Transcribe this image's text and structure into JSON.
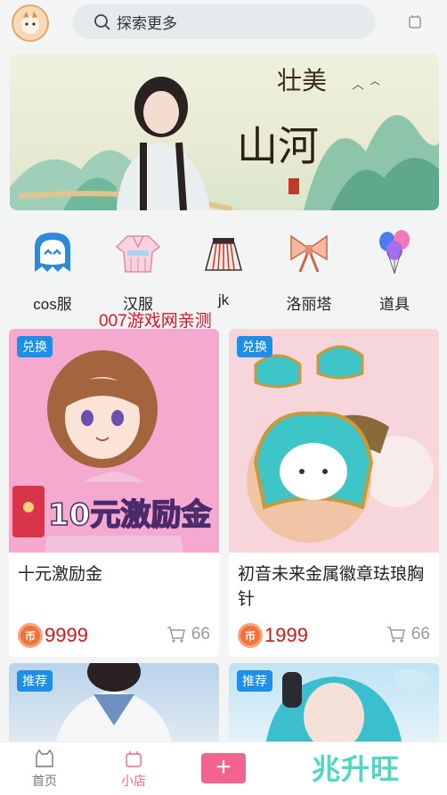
{
  "search": {
    "placeholder": "探索更多"
  },
  "banner": {
    "title_top": "壮美",
    "title_main": "山河"
  },
  "categories": [
    {
      "label": "cos服",
      "icon": "ghost-icon"
    },
    {
      "label": "汉服",
      "icon": "hanfu-icon"
    },
    {
      "label": "jk",
      "icon": "skirt-icon"
    },
    {
      "label": "洛丽塔",
      "icon": "bow-icon"
    },
    {
      "label": "道具",
      "icon": "balloons-icon"
    }
  ],
  "watermark": "007游戏网亲测",
  "products": [
    {
      "tag": "兑换",
      "title": "十元激励金",
      "price": "9999",
      "cart_count": "66",
      "image_text": "10元激励金",
      "coin": "币"
    },
    {
      "tag": "兑换",
      "title": "初音未来金属徽章珐琅胸针",
      "price": "1999",
      "cart_count": "66",
      "coin": "币"
    },
    {
      "tag": "推荐"
    },
    {
      "tag": "推荐"
    }
  ],
  "tabbar": {
    "items": [
      {
        "label": "首页"
      },
      {
        "label": "小店"
      }
    ],
    "plus": "+",
    "brand": "兆升旺"
  },
  "colors": {
    "accent": "#f4628e",
    "price": "#d41616",
    "tag": "#1e8fe8",
    "coin": "#f0743a"
  }
}
